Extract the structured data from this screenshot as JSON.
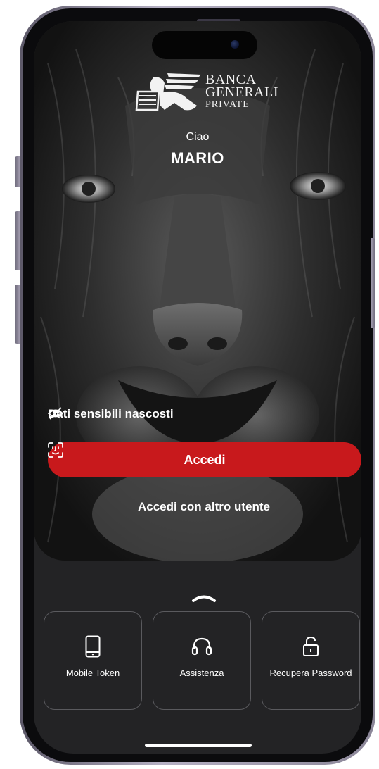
{
  "brand": {
    "line1": "BANCA",
    "line2": "GENERALI",
    "line3": "PRIVATE"
  },
  "greeting": {
    "hello": "Ciao",
    "name": "MARIO"
  },
  "privacy": {
    "label": "Dati sensibili nascosti",
    "icon": "eye-off-icon"
  },
  "login": {
    "label": "Accedi",
    "icon": "face-id-icon",
    "color": "#c8191c"
  },
  "alt_user_label": "Accedi con altro utente",
  "quick_actions": [
    {
      "label": "Mobile Token",
      "icon": "smartphone-icon"
    },
    {
      "label": "Assistenza",
      "icon": "headset-icon"
    },
    {
      "label": "Recupera Password",
      "icon": "unlock-icon"
    }
  ]
}
